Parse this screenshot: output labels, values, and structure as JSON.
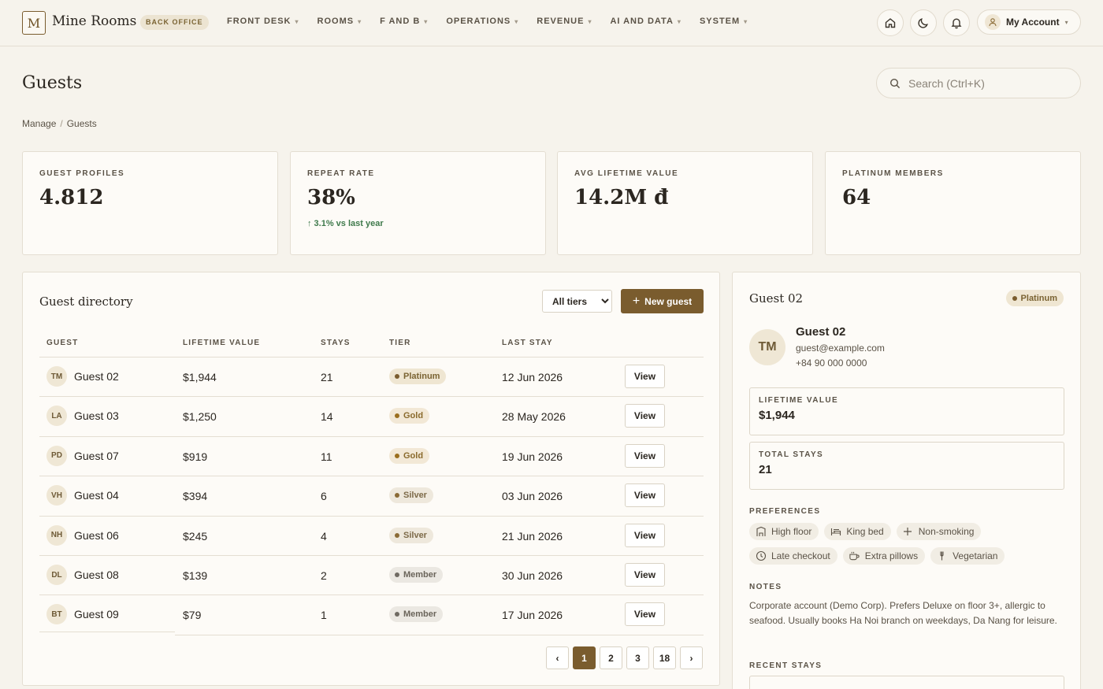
{
  "app": {
    "logo_letter": "M",
    "brand": "Mine Rooms",
    "badge": "BACK OFFICE"
  },
  "nav": [
    {
      "label": "FRONT DESK"
    },
    {
      "label": "ROOMS"
    },
    {
      "label": "F AND B"
    },
    {
      "label": "OPERATIONS"
    },
    {
      "label": "REVENUE"
    },
    {
      "label": "AI AND DATA"
    },
    {
      "label": "SYSTEM"
    }
  ],
  "header_icons": [
    "home-icon",
    "moon-icon",
    "bell-icon"
  ],
  "account": {
    "label": "My Account",
    "icon": "user-icon"
  },
  "page": {
    "title": "Guests",
    "search_placeholder": "Search (Ctrl+K)",
    "breadcrumb": [
      "Manage",
      "Guests"
    ]
  },
  "stats": [
    {
      "label": "GUEST PROFILES",
      "value": "4.812",
      "delta": ""
    },
    {
      "label": "REPEAT RATE",
      "value": "38%",
      "delta": "↑ 3.1% vs last year"
    },
    {
      "label": "AVG LIFETIME VALUE",
      "value": "14.2M đ",
      "delta": ""
    },
    {
      "label": "PLATINUM MEMBERS",
      "value": "64",
      "delta": ""
    }
  ],
  "directory": {
    "title": "Guest directory",
    "filter_options": [
      "All tiers"
    ],
    "filter_selected": "All tiers",
    "new_button": "New guest",
    "columns": [
      "GUEST",
      "LIFETIME VALUE",
      "STAYS",
      "TIER",
      "LAST STAY"
    ],
    "view_label": "View",
    "tier_colors": {
      "Platinum": {
        "bg": "#efe6d2",
        "fg": "#7a6332",
        "dot": "#7a5c2e"
      },
      "Gold": {
        "bg": "#f2e8d6",
        "fg": "#8a6a2c",
        "dot": "#9a6e1e"
      },
      "Silver": {
        "bg": "#eee8dc",
        "fg": "#7d6a48",
        "dot": "#8a6a35"
      },
      "Member": {
        "bg": "#ebe8e2",
        "fg": "#6a645a",
        "dot": "#6f6a62"
      }
    },
    "rows": [
      {
        "initials": "TM",
        "name": "Guest 02",
        "lifetime": "$1,944",
        "stays": "21",
        "tier": "Platinum",
        "last_stay": "12 Jun 2026"
      },
      {
        "initials": "LA",
        "name": "Guest 03",
        "lifetime": "$1,250",
        "stays": "14",
        "tier": "Gold",
        "last_stay": "28 May 2026"
      },
      {
        "initials": "PD",
        "name": "Guest 07",
        "lifetime": "$919",
        "stays": "11",
        "tier": "Gold",
        "last_stay": "19 Jun 2026"
      },
      {
        "initials": "VH",
        "name": "Guest 04",
        "lifetime": "$394",
        "stays": "6",
        "tier": "Silver",
        "last_stay": "03 Jun 2026"
      },
      {
        "initials": "NH",
        "name": "Guest 06",
        "lifetime": "$245",
        "stays": "4",
        "tier": "Silver",
        "last_stay": "21 Jun 2026"
      },
      {
        "initials": "DL",
        "name": "Guest 08",
        "lifetime": "$139",
        "stays": "2",
        "tier": "Member",
        "last_stay": "30 Jun 2026"
      },
      {
        "initials": "BT",
        "name": "Guest 09",
        "lifetime": "$79",
        "stays": "1",
        "tier": "Member",
        "last_stay": "17 Jun 2026"
      }
    ],
    "pagination": {
      "prev": "‹",
      "pages": [
        "1",
        "2",
        "3",
        "18"
      ],
      "current": "1",
      "next": "›"
    }
  },
  "detail": {
    "title": "Guest 02",
    "tier": "Platinum",
    "initials": "TM",
    "name": "Guest 02",
    "email": "guest@example.com",
    "phone": "+84 90 000 0000",
    "lifetime_label": "LIFETIME VALUE",
    "lifetime_value": "$1,944",
    "stays_label": "TOTAL STAYS",
    "stays_value": "21",
    "preferences_label": "PREFERENCES",
    "preferences": [
      {
        "label": "High floor",
        "icon": "building-icon"
      },
      {
        "label": "King bed",
        "icon": "bed-icon"
      },
      {
        "label": "Non-smoking",
        "icon": "plus-icon"
      },
      {
        "label": "Late checkout",
        "icon": "clock-icon"
      },
      {
        "label": "Extra pillows",
        "icon": "cup-icon"
      },
      {
        "label": "Vegetarian",
        "icon": "utensils-icon"
      }
    ],
    "notes_label": "NOTES",
    "notes": "Corporate account (Demo Corp). Prefers Deluxe on floor 3+, allergic to seafood. Usually books Ha Noi branch on weekdays, Da Nang for leisure.",
    "recent_label": "RECENT STAYS"
  }
}
